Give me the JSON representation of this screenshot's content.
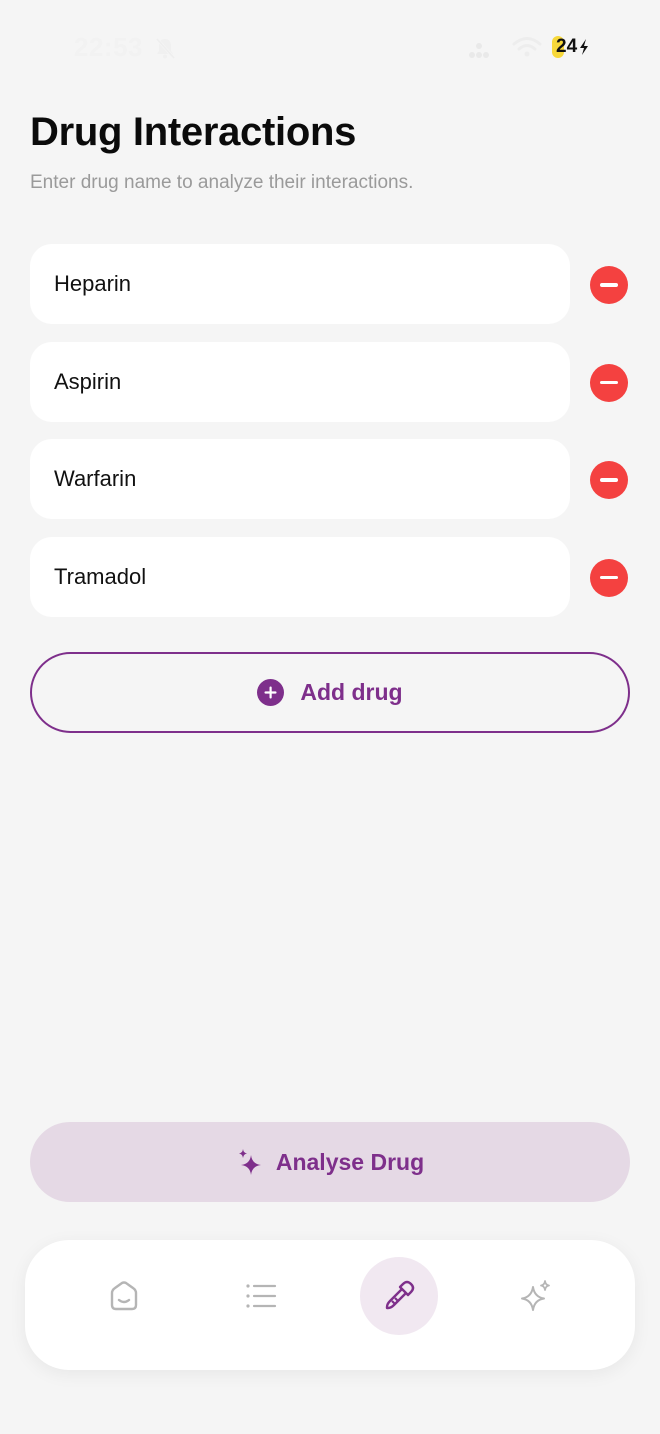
{
  "status_bar": {
    "time": "22:53",
    "battery": "24"
  },
  "header": {
    "title": "Drug Interactions",
    "subtitle": "Enter drug name to analyze their interactions."
  },
  "drugs": [
    {
      "name": "Heparin"
    },
    {
      "name": "Aspirin"
    },
    {
      "name": "Warfarin"
    },
    {
      "name": "Tramadol"
    }
  ],
  "actions": {
    "add_drug_label": "Add drug",
    "analyse_label": "Analyse Drug"
  },
  "tab_bar": {
    "tabs": [
      {
        "icon": "home-icon",
        "active": false
      },
      {
        "icon": "list-icon",
        "active": false
      },
      {
        "icon": "dropper-icon",
        "active": true
      },
      {
        "icon": "sparkles-icon",
        "active": false
      }
    ]
  },
  "colors": {
    "accent": "#7e2f8b",
    "danger": "#f44140",
    "analyse_bg": "#e5d9e5",
    "background": "#f5f5f5"
  }
}
